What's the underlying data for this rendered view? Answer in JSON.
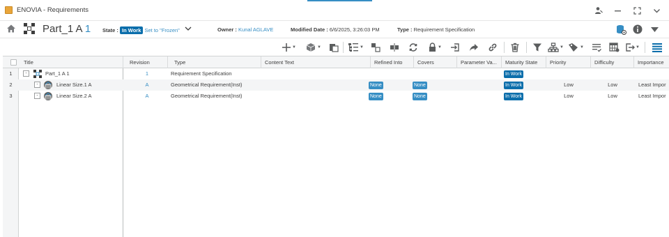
{
  "window": {
    "title": "ENOVIA - Requirements",
    "icons": [
      "app-logo",
      "user-share-icon",
      "minimize-icon",
      "fullscreen-icon",
      "chevron-down-icon"
    ]
  },
  "header": {
    "name": "Part_1 A",
    "revision": "1",
    "state_label": "State :",
    "state_value": "In Work",
    "state_action": "Set to \"Frozen\"",
    "owner_label": "Owner :",
    "owner_value": "Kunal AGLAVE",
    "modified_label": "Modified Date :",
    "modified_value": "6/6/2025, 3:26:03 PM",
    "type_label": "Type :",
    "type_value": "Requirement Specification"
  },
  "toolbar": {
    "icons": [
      "add-icon",
      "insert-icon",
      "paste-icon",
      "structure-icon",
      "replace-icon",
      "split-icon",
      "refresh-icon",
      "lock-icon",
      "import-icon",
      "share-icon",
      "link-icon",
      "delete-icon",
      "filter-icon",
      "hierarchy-icon",
      "tag-icon",
      "checklist-icon",
      "table-settings-icon",
      "export-icon",
      "menu-icon"
    ]
  },
  "grid": {
    "columns": [
      "Title",
      "Revision",
      "Type",
      "Content Text",
      "Refined Into",
      "Covers",
      "Parameter Va...",
      "Maturity State",
      "Priority",
      "Difficulty",
      "Importance"
    ],
    "rows": [
      {
        "num": "1",
        "expander": "-",
        "title": "Part_1 A  1",
        "revision": "1",
        "type": "Requirement Specification",
        "content": "",
        "refined": "",
        "covers": "",
        "param": "",
        "maturity": "In Work",
        "priority": "",
        "difficulty": "",
        "importance": ""
      },
      {
        "num": "2",
        "expander": "-",
        "title": "Linear Size.1  A",
        "revision": "A",
        "type": "Geometrical Requirement(Inst)",
        "content": "",
        "refined": "None",
        "covers": "None",
        "param": "",
        "maturity": "In Work",
        "priority": "Low",
        "difficulty": "Low",
        "importance": "Least Impor"
      },
      {
        "num": "3",
        "expander": "-",
        "title": "Linear Size.2  A",
        "revision": "A",
        "type": "Geometrical Requirement(Inst)",
        "content": "",
        "refined": "None",
        "covers": "None",
        "param": "",
        "maturity": "In Work",
        "priority": "Low",
        "difficulty": "Low",
        "importance": "Least Impor"
      }
    ]
  },
  "colors": {
    "accent": "#368ec4",
    "state_badge": "#0b6eab",
    "text": "#3d3d3d",
    "stripe": "#f4f5f6"
  }
}
